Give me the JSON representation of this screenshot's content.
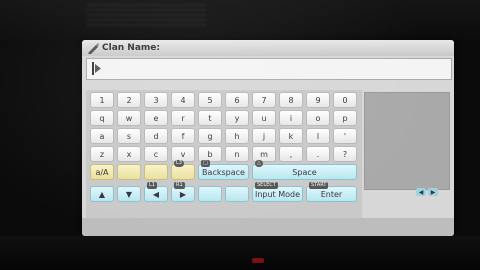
{
  "dialog": {
    "title": "Clan Name:",
    "input_value": ""
  },
  "keyboard": {
    "rows": [
      [
        "1",
        "2",
        "3",
        "4",
        "5",
        "6",
        "7",
        "8",
        "9",
        "0"
      ],
      [
        "q",
        "w",
        "e",
        "r",
        "t",
        "y",
        "u",
        "i",
        "o",
        "p"
      ],
      [
        "a",
        "s",
        "d",
        "f",
        "g",
        "h",
        "j",
        "k",
        "l",
        "'"
      ],
      [
        "z",
        "x",
        "c",
        "v",
        "b",
        "n",
        "m",
        ",",
        ".",
        "?"
      ]
    ],
    "shift_label": "a/A",
    "backspace_label": "Backspace",
    "space_label": "Space",
    "input_mode_label": "Input Mode",
    "enter_label": "Enter",
    "badges": {
      "shift": "L3",
      "backspace": "□",
      "space": "△",
      "input_mode": "SELECT",
      "enter": "START"
    },
    "arrows": [
      "▲",
      "▼",
      "◀",
      "▶"
    ],
    "preview_arrows": [
      "◀",
      "▶"
    ]
  },
  "colors": {
    "screen_bg": "#d7d7d7",
    "key_white": "#ffffff",
    "key_yellow": "#eadf9c",
    "key_cyan": "#b7e7ef"
  }
}
